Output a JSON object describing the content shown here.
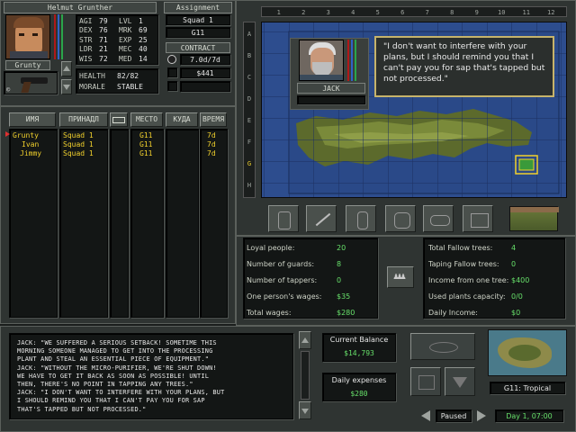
{
  "merc": {
    "name": "Helmut Grunther",
    "nickname": "Grunty",
    "stats": [
      {
        "label": "AGI",
        "value": "79"
      },
      {
        "label": "DEX",
        "value": "76"
      },
      {
        "label": "STR",
        "value": "71"
      },
      {
        "label": "LDR",
        "value": "21"
      },
      {
        "label": "WIS",
        "value": "72"
      }
    ],
    "stats2": [
      {
        "label": "LVL",
        "value": "1"
      },
      {
        "label": "MRK",
        "value": "69"
      },
      {
        "label": "EXP",
        "value": "25"
      },
      {
        "label": "MEC",
        "value": "40"
      },
      {
        "label": "MED",
        "value": "14"
      }
    ],
    "health_label": "Health",
    "health_value": "82/82",
    "morale_label": "Morale",
    "morale_value": "Stable"
  },
  "assignment": {
    "header": "Assignment",
    "squad": "Squad 1",
    "sector": "G11",
    "contract_label": "Contract",
    "contract_time": "7.0d/7d",
    "contract_cost": "$441"
  },
  "team_table": {
    "columns": [
      "ИМЯ",
      "ПРИНАДЛ",
      "",
      "МЕСТО",
      "КУДА",
      "ВРЕМЯ"
    ],
    "rows": [
      {
        "name": "Grunty",
        "assign": "Squad 1",
        "loc": "G11",
        "time": "7d"
      },
      {
        "name": "Ivan",
        "assign": "Squad 1",
        "loc": "G11",
        "time": "7d"
      },
      {
        "name": "Jimmy",
        "assign": "Squad 1",
        "loc": "G11",
        "time": "7d"
      }
    ]
  },
  "map": {
    "cols": [
      "1",
      "2",
      "3",
      "4",
      "5",
      "6",
      "7",
      "8",
      "9",
      "10",
      "11",
      "12"
    ],
    "rows": [
      "A",
      "B",
      "C",
      "D",
      "E",
      "F",
      "G",
      "H"
    ]
  },
  "dialog": {
    "speaker": "Jack",
    "text": "\"I don't want to interfere with your plans, but I should remind you that I can't pay you for sap that's tapped but not processed.\""
  },
  "stats_panel": {
    "left": [
      {
        "label": "Loyal people:",
        "value": "20"
      },
      {
        "label": "Number of guards:",
        "value": "8"
      },
      {
        "label": "Number of tappers:",
        "value": "0"
      },
      {
        "label": "One person's wages:",
        "value": "$35"
      },
      {
        "label": "Total wages:",
        "value": "$280"
      }
    ],
    "right": [
      {
        "label": "Total Fallow trees:",
        "value": "4"
      },
      {
        "label": "Taping Fallow trees:",
        "value": "0"
      },
      {
        "label": "Income from one tree:",
        "value": "$400"
      },
      {
        "label": "Used plants capacity:",
        "value": "0/0"
      },
      {
        "label": "Daily Income:",
        "value": "$0"
      }
    ]
  },
  "log": {
    "lines": [
      "JACK: \"WE SUFFERED A SERIOUS SETBACK! SOMETIME THIS",
      "MORNING SOMEONE MANAGED TO GET INTO THE PROCESSING",
      "PLANT AND STEAL AN ESSENTIAL PIECE OF EQUIPMENT.\"",
      "JACK: \"WITHOUT THE MICRO-PURIFIER, WE'RE SHUT DOWN!",
      "WE HAVE TO GET IT BACK AS SOON AS POSSIBLE! UNTIL",
      "THEN, THERE'S NO POINT IN TAPPING ANY TREES.\"",
      "JACK: \"I DON'T WANT TO INTERFERE WITH YOUR PLANS, BUT",
      "I SHOULD REMIND YOU THAT I CAN'T PAY YOU FOR SAP",
      "THAT'S TAPPED BUT NOT PROCESSED.\""
    ]
  },
  "finance": {
    "balance_label": "Current Balance",
    "balance_value": "$14,793",
    "expenses_label": "Daily expenses",
    "expenses_value": "$280"
  },
  "status": {
    "sector_label": "G11: Tropical",
    "paused": "Paused",
    "clock": "Day 1, 07:00"
  },
  "colors": {
    "highlight": "#f2d12c",
    "money": "#67e06a",
    "panel": "#2b302e"
  }
}
